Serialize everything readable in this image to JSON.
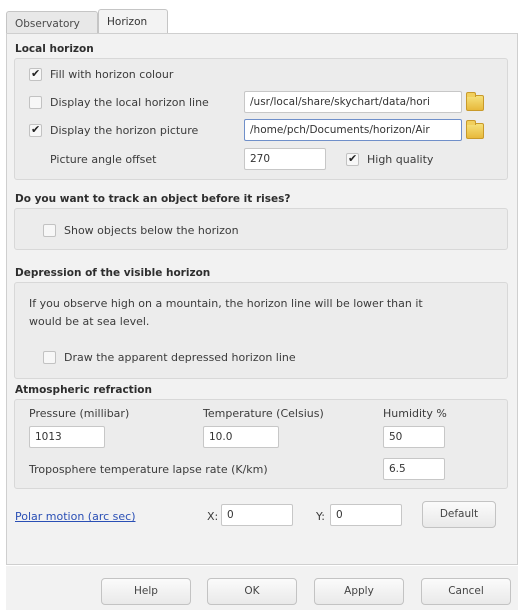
{
  "tabs": [
    {
      "label": "Observatory"
    },
    {
      "label": "Horizon"
    }
  ],
  "local_horizon": {
    "title": "Local horizon",
    "fill_color": {
      "label": "Fill with horizon colour",
      "checked": true
    },
    "display_line": {
      "label": "Display the local horizon line",
      "checked": false,
      "path": "/usr/local/share/skychart/data/hori"
    },
    "display_picture": {
      "label": "Display the horizon picture",
      "checked": true,
      "path": "/home/pch/Documents/horizon/Air"
    },
    "angle_offset": {
      "label": "Picture angle offset",
      "value": "270"
    },
    "high_quality": {
      "label": "High quality",
      "checked": true
    }
  },
  "track": {
    "title": "Do you want to track an object before it rises?",
    "show_below": {
      "label": "Show objects below the horizon",
      "checked": false
    }
  },
  "depression": {
    "title": "Depression of the visible horizon",
    "note_line1": "If you observe high on a mountain, the horizon line will be lower than it",
    "note_line2": "would be at sea level.",
    "draw_depressed": {
      "label": "Draw the apparent depressed horizon line",
      "checked": false
    }
  },
  "refraction": {
    "title": "Atmospheric refraction",
    "pressure_label": "Pressure (millibar)",
    "pressure_value": "1013",
    "temperature_label": "Temperature (Celsius)",
    "temperature_value": "10.0",
    "humidity_label": "Humidity %",
    "humidity_value": "50",
    "lapse_label": "Troposphere temperature lapse rate (K/km)",
    "lapse_value": "6.5"
  },
  "polar": {
    "link": "Polar motion (arc sec)",
    "x_label": "X:",
    "x_value": "0",
    "y_label": "Y:",
    "y_value": "0",
    "default_label": "Default"
  },
  "buttons": {
    "help": "Help",
    "ok": "OK",
    "apply": "Apply",
    "cancel": "Cancel"
  },
  "icons": {
    "folder": "folder-icon",
    "check": "checkmark-icon"
  }
}
